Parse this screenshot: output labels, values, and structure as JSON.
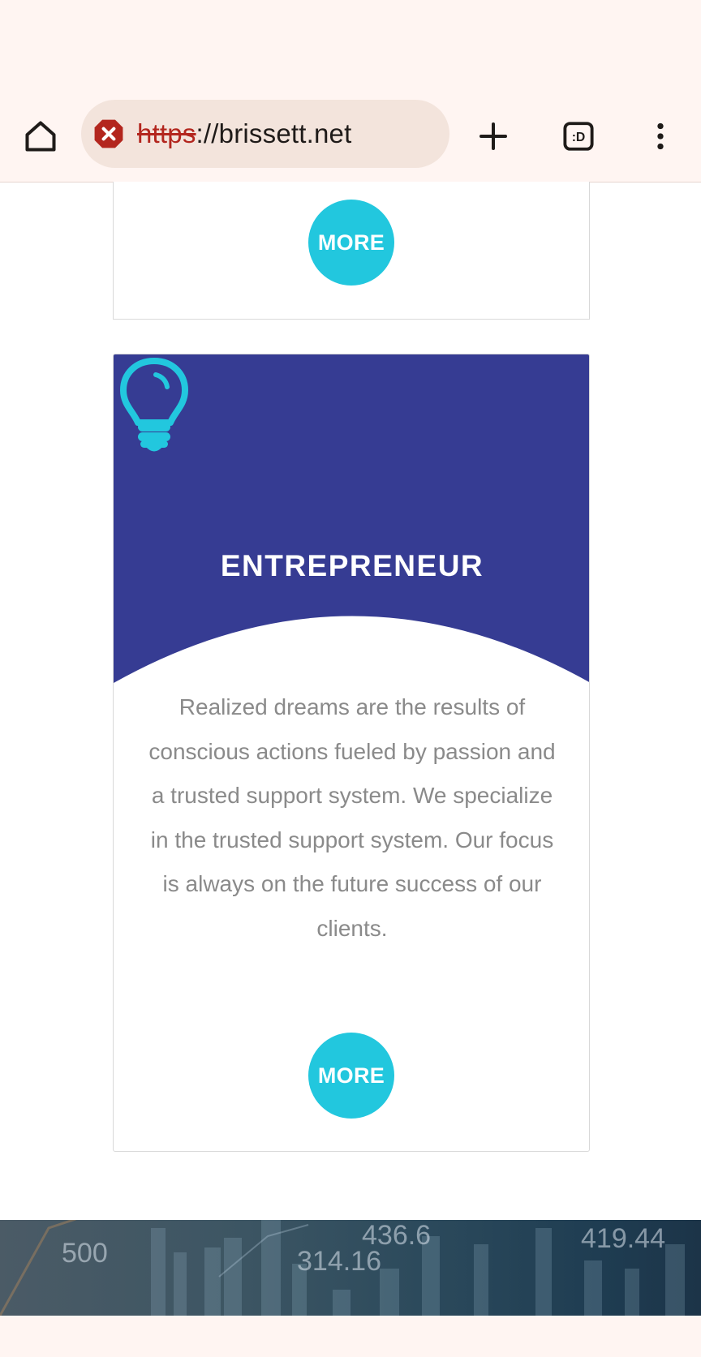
{
  "browser": {
    "url_scheme": "https",
    "url_rest": "://brissett.net",
    "tab_switcher_label": ":D",
    "security_status": "not-secure",
    "icons": [
      "home-icon",
      "not-secure-icon",
      "plus-icon",
      "tab-switcher-icon",
      "more-vert-icon"
    ]
  },
  "previous_card": {
    "more_label": "MORE"
  },
  "card": {
    "icon": "lightbulb-icon",
    "title": "ENTREPRENEUR",
    "text": "Realized dreams are the results of conscious actions fueled by passion and a trusted support system. We specialize in the trusted support system. Our focus is always on the future success of our clients.",
    "more_label": "MORE",
    "colors": {
      "header": "#363c93",
      "accent": "#22c7de",
      "text": "#8a8a8a"
    }
  },
  "banner": {
    "figures": [
      "500",
      "436.6",
      "314.16",
      "419.44"
    ]
  }
}
